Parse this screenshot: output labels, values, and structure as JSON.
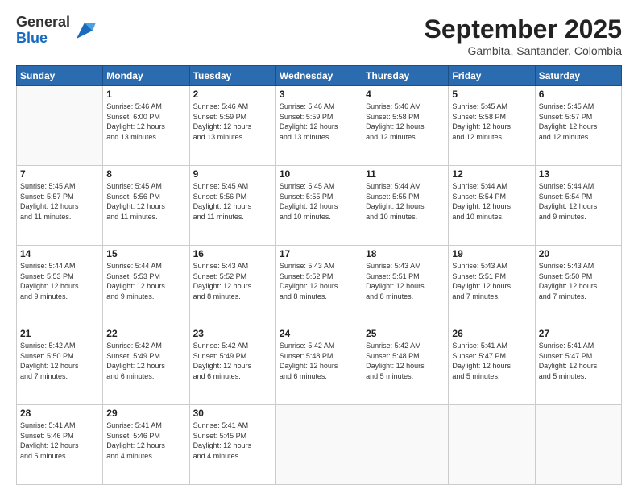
{
  "header": {
    "logo_general": "General",
    "logo_blue": "Blue",
    "month_title": "September 2025",
    "location": "Gambita, Santander, Colombia"
  },
  "weekdays": [
    "Sunday",
    "Monday",
    "Tuesday",
    "Wednesday",
    "Thursday",
    "Friday",
    "Saturday"
  ],
  "weeks": [
    [
      {
        "day": "",
        "info": ""
      },
      {
        "day": "1",
        "info": "Sunrise: 5:46 AM\nSunset: 6:00 PM\nDaylight: 12 hours\nand 13 minutes."
      },
      {
        "day": "2",
        "info": "Sunrise: 5:46 AM\nSunset: 5:59 PM\nDaylight: 12 hours\nand 13 minutes."
      },
      {
        "day": "3",
        "info": "Sunrise: 5:46 AM\nSunset: 5:59 PM\nDaylight: 12 hours\nand 13 minutes."
      },
      {
        "day": "4",
        "info": "Sunrise: 5:46 AM\nSunset: 5:58 PM\nDaylight: 12 hours\nand 12 minutes."
      },
      {
        "day": "5",
        "info": "Sunrise: 5:45 AM\nSunset: 5:58 PM\nDaylight: 12 hours\nand 12 minutes."
      },
      {
        "day": "6",
        "info": "Sunrise: 5:45 AM\nSunset: 5:57 PM\nDaylight: 12 hours\nand 12 minutes."
      }
    ],
    [
      {
        "day": "7",
        "info": "Sunrise: 5:45 AM\nSunset: 5:57 PM\nDaylight: 12 hours\nand 11 minutes."
      },
      {
        "day": "8",
        "info": "Sunrise: 5:45 AM\nSunset: 5:56 PM\nDaylight: 12 hours\nand 11 minutes."
      },
      {
        "day": "9",
        "info": "Sunrise: 5:45 AM\nSunset: 5:56 PM\nDaylight: 12 hours\nand 11 minutes."
      },
      {
        "day": "10",
        "info": "Sunrise: 5:45 AM\nSunset: 5:55 PM\nDaylight: 12 hours\nand 10 minutes."
      },
      {
        "day": "11",
        "info": "Sunrise: 5:44 AM\nSunset: 5:55 PM\nDaylight: 12 hours\nand 10 minutes."
      },
      {
        "day": "12",
        "info": "Sunrise: 5:44 AM\nSunset: 5:54 PM\nDaylight: 12 hours\nand 10 minutes."
      },
      {
        "day": "13",
        "info": "Sunrise: 5:44 AM\nSunset: 5:54 PM\nDaylight: 12 hours\nand 9 minutes."
      }
    ],
    [
      {
        "day": "14",
        "info": "Sunrise: 5:44 AM\nSunset: 5:53 PM\nDaylight: 12 hours\nand 9 minutes."
      },
      {
        "day": "15",
        "info": "Sunrise: 5:44 AM\nSunset: 5:53 PM\nDaylight: 12 hours\nand 9 minutes."
      },
      {
        "day": "16",
        "info": "Sunrise: 5:43 AM\nSunset: 5:52 PM\nDaylight: 12 hours\nand 8 minutes."
      },
      {
        "day": "17",
        "info": "Sunrise: 5:43 AM\nSunset: 5:52 PM\nDaylight: 12 hours\nand 8 minutes."
      },
      {
        "day": "18",
        "info": "Sunrise: 5:43 AM\nSunset: 5:51 PM\nDaylight: 12 hours\nand 8 minutes."
      },
      {
        "day": "19",
        "info": "Sunrise: 5:43 AM\nSunset: 5:51 PM\nDaylight: 12 hours\nand 7 minutes."
      },
      {
        "day": "20",
        "info": "Sunrise: 5:43 AM\nSunset: 5:50 PM\nDaylight: 12 hours\nand 7 minutes."
      }
    ],
    [
      {
        "day": "21",
        "info": "Sunrise: 5:42 AM\nSunset: 5:50 PM\nDaylight: 12 hours\nand 7 minutes."
      },
      {
        "day": "22",
        "info": "Sunrise: 5:42 AM\nSunset: 5:49 PM\nDaylight: 12 hours\nand 6 minutes."
      },
      {
        "day": "23",
        "info": "Sunrise: 5:42 AM\nSunset: 5:49 PM\nDaylight: 12 hours\nand 6 minutes."
      },
      {
        "day": "24",
        "info": "Sunrise: 5:42 AM\nSunset: 5:48 PM\nDaylight: 12 hours\nand 6 minutes."
      },
      {
        "day": "25",
        "info": "Sunrise: 5:42 AM\nSunset: 5:48 PM\nDaylight: 12 hours\nand 5 minutes."
      },
      {
        "day": "26",
        "info": "Sunrise: 5:41 AM\nSunset: 5:47 PM\nDaylight: 12 hours\nand 5 minutes."
      },
      {
        "day": "27",
        "info": "Sunrise: 5:41 AM\nSunset: 5:47 PM\nDaylight: 12 hours\nand 5 minutes."
      }
    ],
    [
      {
        "day": "28",
        "info": "Sunrise: 5:41 AM\nSunset: 5:46 PM\nDaylight: 12 hours\nand 5 minutes."
      },
      {
        "day": "29",
        "info": "Sunrise: 5:41 AM\nSunset: 5:46 PM\nDaylight: 12 hours\nand 4 minutes."
      },
      {
        "day": "30",
        "info": "Sunrise: 5:41 AM\nSunset: 5:45 PM\nDaylight: 12 hours\nand 4 minutes."
      },
      {
        "day": "",
        "info": ""
      },
      {
        "day": "",
        "info": ""
      },
      {
        "day": "",
        "info": ""
      },
      {
        "day": "",
        "info": ""
      }
    ]
  ]
}
